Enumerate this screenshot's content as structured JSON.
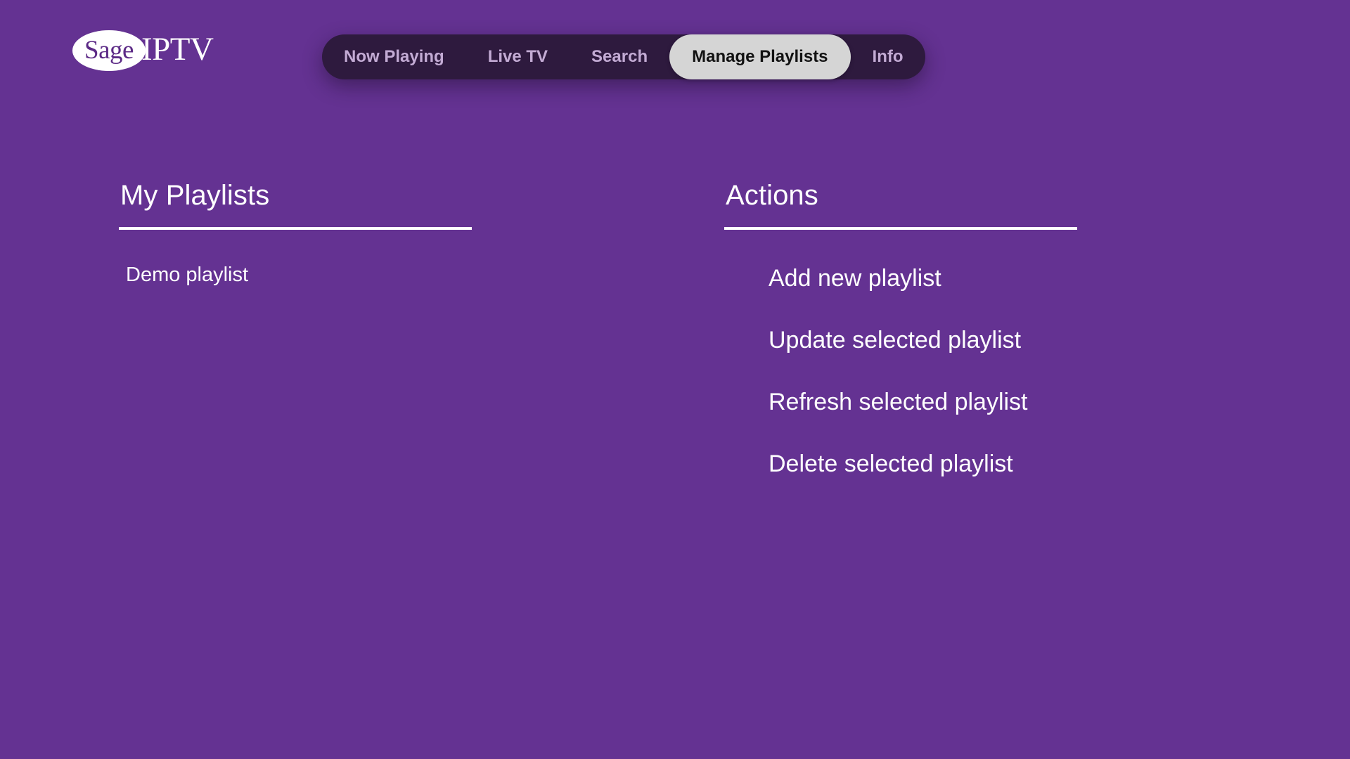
{
  "theme": {
    "background": "#643292",
    "nav_background": "#2e1a3e",
    "nav_text": "#c3abd4",
    "nav_active_background": "#d5d5d5",
    "nav_active_text": "#121212",
    "text": "#ffffff",
    "logo_badge_background": "#ffffff",
    "logo_badge_text": "#5c2a86"
  },
  "header": {
    "logo": {
      "badge_text": "Sage",
      "word_text": "IPTV"
    },
    "nav": {
      "items": [
        {
          "label": "Now Playing",
          "active": false
        },
        {
          "label": "Live TV",
          "active": false
        },
        {
          "label": "Search",
          "active": false
        },
        {
          "label": "Manage Playlists",
          "active": true
        },
        {
          "label": "Info",
          "active": false
        }
      ]
    }
  },
  "main": {
    "playlists_panel": {
      "title": "My Playlists",
      "items": [
        {
          "label": "Demo playlist"
        }
      ]
    },
    "actions_panel": {
      "title": "Actions",
      "items": [
        {
          "label": "Add new playlist"
        },
        {
          "label": "Update selected playlist"
        },
        {
          "label": "Refresh selected playlist"
        },
        {
          "label": "Delete selected playlist"
        }
      ]
    }
  }
}
